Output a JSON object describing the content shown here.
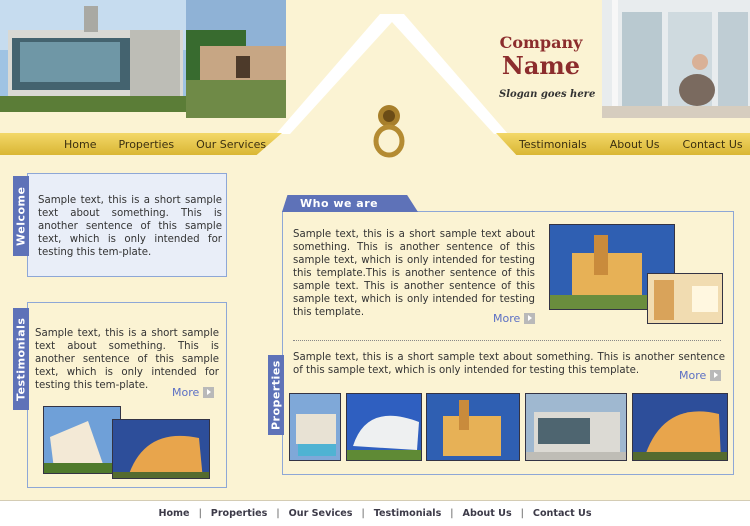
{
  "header": {
    "company_line1": "Company",
    "company_line2": "Name",
    "slogan": "Slogan goes here"
  },
  "nav_left": [
    "Home",
    "Properties",
    "Our Services"
  ],
  "nav_right": [
    "Testimonials",
    "About Us",
    "Contact Us"
  ],
  "welcome": {
    "tab": "Welcome",
    "text": "Sample text, this is a short sample text about something. This is another sentence of this sample text, which is only intended for testing this tem-plate."
  },
  "testimonials": {
    "tab": "Testimonials",
    "text": "Sample text, this is a short sample text about something. This is another sentence of this sample text, which is only intended for testing this tem-plate.",
    "more": "More"
  },
  "who": {
    "title": "Who we are",
    "text": "Sample text, this is a short sample text about something. This is another sentence of this sample text, which is only intended for testing this template.This is another sentence of this sample text. This is another sentence of this sample text, which is only intended for testing this template.",
    "more": "More"
  },
  "properties": {
    "tab": "Properties",
    "text": "Sample text, this is a short sample text about something. This is another sentence of this sample text, which is only intended for testing this template.",
    "more": "More"
  },
  "footer": [
    "Home",
    "Properties",
    "Our Sevices",
    "Testimonials",
    "About Us",
    "Contact Us"
  ],
  "colors": {
    "accent": "#5e72b8",
    "nav": "#e8c84a",
    "brand": "#8c2d2d",
    "bg": "#fbf3d3"
  }
}
